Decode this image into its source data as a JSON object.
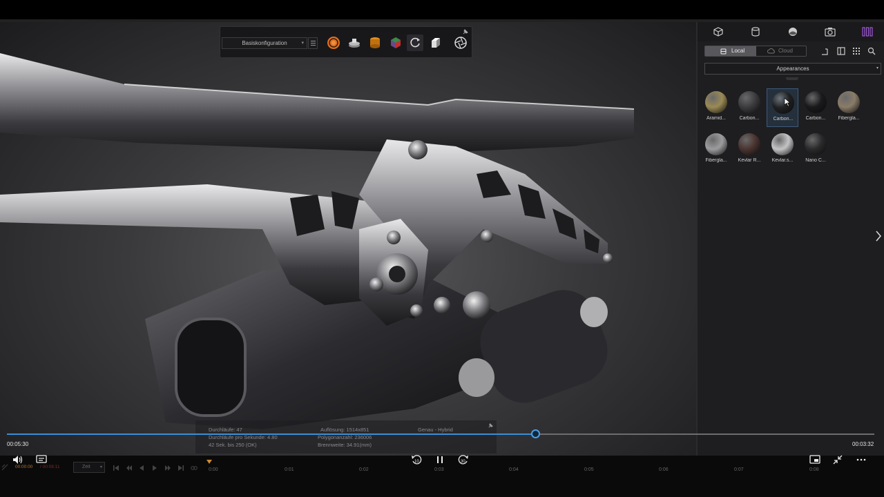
{
  "toolbar": {
    "preset_value": "Basiskonfiguration"
  },
  "panel": {
    "tabs": [
      "cube-icon",
      "database-icon",
      "environment-icon",
      "camera-icon",
      "library-icon"
    ],
    "local_label": "Local",
    "cloud_label": "Cloud",
    "category_value": "Appearances",
    "materials": [
      {
        "label": "Aramid...",
        "color": "#9a8a55"
      },
      {
        "label": "Carbon...",
        "color": "#3c3c3e"
      },
      {
        "label": "Carbon...",
        "color": "#202022"
      },
      {
        "label": "Carbon...",
        "color": "#1a1a1c"
      },
      {
        "label": "Fibergla...",
        "color": "#8a7c68"
      },
      {
        "label": "Fibergla...",
        "color": "#9c9c9e"
      },
      {
        "label": "Kevlar R...",
        "color": "#4a3430"
      },
      {
        "label": "Kevlar.s...",
        "color": "#c4c4c6"
      },
      {
        "label": "Nano C...",
        "color": "#2a2a2c"
      }
    ]
  },
  "info": {
    "passes": "Durchläufe: 47",
    "passes_per_sec": "Durchläufe pro Sekunde: 4.80",
    "time_left": "42 Sek. bis 250 (OK)",
    "resolution": "Auflösung: 1514x851",
    "polygons": "Polygonanzahl: 236006",
    "focal": "Brennweite: 34.91(mm)",
    "mode": "Genau - Hybrid"
  },
  "player": {
    "current_time": "00:05:30",
    "duration": "00:03:32",
    "progress": 0.609
  },
  "timeline": {
    "time_current": "00:00:00",
    "time_end": "/ 00:08:11",
    "mode_value": "Zeit",
    "labels": [
      "0:00",
      "0:01",
      "0:02",
      "0:03",
      "0:04",
      "0:05",
      "0:06",
      "0:07",
      "0:08"
    ]
  }
}
